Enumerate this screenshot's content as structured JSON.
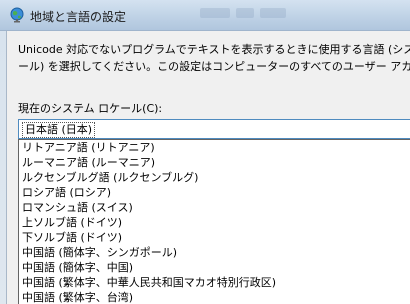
{
  "window": {
    "title": "地域と言語の設定"
  },
  "icons": {
    "title": "globe-icon"
  },
  "dialog": {
    "description_lines": [
      "Unicode 対応でないプログラムでテキストを表示するときに使用する言語 (システム",
      "ール) を選択してください。この設定はコンピューターのすべてのユーザー アカウントに影"
    ],
    "locale_label": "現在のシステム ロケール(C):",
    "selected_locale": "日本語 (日本)"
  },
  "dropdown": {
    "options": [
      "リトアニア語 (リトアニア)",
      "ルーマニア語 (ルーマニア)",
      "ルクセンブルグ語 (ルクセンブルグ)",
      "ロシア語 (ロシア)",
      "ロマンシュ語 (スイス)",
      "上ソルブ語 (ドイツ)",
      "下ソルブ語 (ドイツ)",
      "中国語 (簡体字、シンガポール)",
      "中国語 (簡体字、中国)",
      "中国語 (繁体字、中華人民共和国マカオ特別行政区)",
      "中国語 (繁体字、台湾)"
    ]
  }
}
